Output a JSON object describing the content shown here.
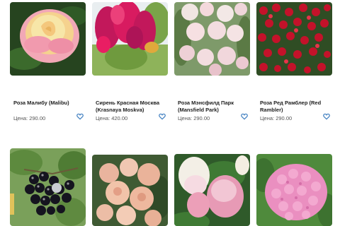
{
  "products": [
    {
      "name": "Роза Малибу (Malibu)",
      "price_label": "Цена:",
      "price": "290.00"
    },
    {
      "name": "Сирень Красная Москва (Krasnaya Moskva)",
      "price_label": "Цена:",
      "price": "420.00"
    },
    {
      "name": "Роза Мэнсфилд Парк (Mansfield Park)",
      "price_label": "Цена:",
      "price": "290.00"
    },
    {
      "name": "Роза Ред Рамблер (Red Rambler)",
      "price_label": "Цена:",
      "price": "290.00"
    },
    {
      "name": ""
    },
    {
      "name": ""
    },
    {
      "name": ""
    },
    {
      "name": ""
    }
  ],
  "icons": {
    "favorite": "heart-outline-icon"
  },
  "colors": {
    "favorite": "#3f7fc0",
    "price_text": "#555555"
  }
}
